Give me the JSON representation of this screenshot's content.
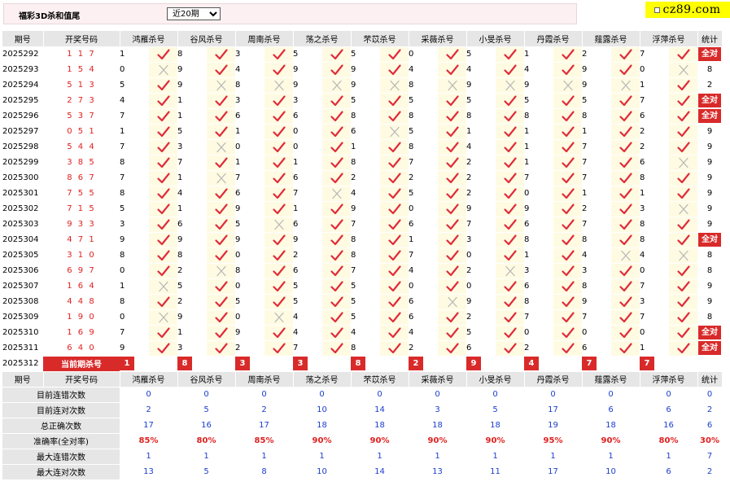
{
  "header": {
    "title": "福彩3D杀和值尾",
    "period_option": "近20期",
    "logo": "cz89.com"
  },
  "columns": [
    "期号",
    "开奖号码",
    "鸿雁杀号",
    "谷风杀号",
    "周南杀号",
    "荡之杀号",
    "芣苡杀号",
    "采薇杀号",
    "小旻杀号",
    "丹霞杀号",
    "薤露杀号",
    "浮萍杀号",
    "统计"
  ],
  "rows": [
    {
      "period": "2025292",
      "draw": "1 1 7",
      "kills": [
        [
          "1",
          "y"
        ],
        [
          "8",
          "y"
        ],
        [
          "3",
          "y"
        ],
        [
          "5",
          "y"
        ],
        [
          "5",
          "y"
        ],
        [
          "0",
          "y"
        ],
        [
          "5",
          "y"
        ],
        [
          "1",
          "y"
        ],
        [
          "2",
          "y"
        ],
        [
          "7",
          "y"
        ]
      ],
      "stat": "全对"
    },
    {
      "period": "2025293",
      "draw": "1 5 4",
      "kills": [
        [
          "0",
          "n"
        ],
        [
          "9",
          "y"
        ],
        [
          "4",
          "y"
        ],
        [
          "9",
          "y"
        ],
        [
          "9",
          "y"
        ],
        [
          "4",
          "y"
        ],
        [
          "4",
          "y"
        ],
        [
          "4",
          "y"
        ],
        [
          "9",
          "y"
        ],
        [
          "0",
          "n"
        ]
      ],
      "stat": "8"
    },
    {
      "period": "2025294",
      "draw": "5 1 3",
      "kills": [
        [
          "5",
          "y"
        ],
        [
          "9",
          "n"
        ],
        [
          "8",
          "n"
        ],
        [
          "9",
          "n"
        ],
        [
          "9",
          "n"
        ],
        [
          "8",
          "n"
        ],
        [
          "9",
          "n"
        ],
        [
          "9",
          "n"
        ],
        [
          "9",
          "n"
        ],
        [
          "1",
          "y"
        ]
      ],
      "stat": "2"
    },
    {
      "period": "2025295",
      "draw": "2 7 3",
      "kills": [
        [
          "4",
          "y"
        ],
        [
          "1",
          "y"
        ],
        [
          "3",
          "y"
        ],
        [
          "3",
          "y"
        ],
        [
          "5",
          "y"
        ],
        [
          "5",
          "y"
        ],
        [
          "5",
          "y"
        ],
        [
          "5",
          "y"
        ],
        [
          "5",
          "y"
        ],
        [
          "7",
          "y"
        ]
      ],
      "stat": "全对"
    },
    {
      "period": "2025296",
      "draw": "5 3 7",
      "kills": [
        [
          "7",
          "y"
        ],
        [
          "1",
          "y"
        ],
        [
          "6",
          "y"
        ],
        [
          "6",
          "y"
        ],
        [
          "8",
          "y"
        ],
        [
          "8",
          "y"
        ],
        [
          "8",
          "y"
        ],
        [
          "8",
          "y"
        ],
        [
          "8",
          "y"
        ],
        [
          "6",
          "y"
        ]
      ],
      "stat": "全对"
    },
    {
      "period": "2025297",
      "draw": "0 5 1",
      "kills": [
        [
          "1",
          "y"
        ],
        [
          "5",
          "y"
        ],
        [
          "1",
          "y"
        ],
        [
          "0",
          "y"
        ],
        [
          "6",
          "n"
        ],
        [
          "5",
          "y"
        ],
        [
          "1",
          "y"
        ],
        [
          "1",
          "y"
        ],
        [
          "1",
          "y"
        ],
        [
          "2",
          "y"
        ]
      ],
      "stat": "9"
    },
    {
      "period": "2025298",
      "draw": "5 4 4",
      "kills": [
        [
          "7",
          "y"
        ],
        [
          "3",
          "n"
        ],
        [
          "0",
          "y"
        ],
        [
          "0",
          "y"
        ],
        [
          "1",
          "y"
        ],
        [
          "8",
          "y"
        ],
        [
          "4",
          "y"
        ],
        [
          "1",
          "y"
        ],
        [
          "7",
          "y"
        ],
        [
          "2",
          "y"
        ]
      ],
      "stat": "9"
    },
    {
      "period": "2025299",
      "draw": "3 8 5",
      "kills": [
        [
          "8",
          "y"
        ],
        [
          "7",
          "y"
        ],
        [
          "1",
          "y"
        ],
        [
          "1",
          "y"
        ],
        [
          "8",
          "y"
        ],
        [
          "7",
          "y"
        ],
        [
          "2",
          "y"
        ],
        [
          "1",
          "y"
        ],
        [
          "7",
          "y"
        ],
        [
          "6",
          "n"
        ]
      ],
      "stat": "9"
    },
    {
      "period": "2025300",
      "draw": "8 6 7",
      "kills": [
        [
          "7",
          "y"
        ],
        [
          "1",
          "n"
        ],
        [
          "7",
          "y"
        ],
        [
          "6",
          "y"
        ],
        [
          "2",
          "y"
        ],
        [
          "2",
          "y"
        ],
        [
          "2",
          "y"
        ],
        [
          "7",
          "y"
        ],
        [
          "7",
          "y"
        ],
        [
          "8",
          "y"
        ]
      ],
      "stat": "9"
    },
    {
      "period": "2025301",
      "draw": "7 5 5",
      "kills": [
        [
          "8",
          "y"
        ],
        [
          "4",
          "y"
        ],
        [
          "6",
          "y"
        ],
        [
          "7",
          "n"
        ],
        [
          "4",
          "y"
        ],
        [
          "5",
          "y"
        ],
        [
          "2",
          "y"
        ],
        [
          "0",
          "y"
        ],
        [
          "1",
          "y"
        ],
        [
          "1",
          "y"
        ]
      ],
      "stat": "9"
    },
    {
      "period": "2025302",
      "draw": "7 1 5",
      "kills": [
        [
          "5",
          "y"
        ],
        [
          "1",
          "y"
        ],
        [
          "9",
          "y"
        ],
        [
          "1",
          "y"
        ],
        [
          "9",
          "y"
        ],
        [
          "0",
          "y"
        ],
        [
          "9",
          "y"
        ],
        [
          "9",
          "y"
        ],
        [
          "2",
          "y"
        ],
        [
          "3",
          "n"
        ]
      ],
      "stat": "9"
    },
    {
      "period": "2025303",
      "draw": "9 3 3",
      "kills": [
        [
          "3",
          "y"
        ],
        [
          "6",
          "y"
        ],
        [
          "5",
          "n"
        ],
        [
          "6",
          "y"
        ],
        [
          "7",
          "y"
        ],
        [
          "6",
          "y"
        ],
        [
          "7",
          "y"
        ],
        [
          "6",
          "y"
        ],
        [
          "7",
          "y"
        ],
        [
          "8",
          "y"
        ]
      ],
      "stat": "9"
    },
    {
      "period": "2025304",
      "draw": "4 7 1",
      "kills": [
        [
          "9",
          "y"
        ],
        [
          "9",
          "y"
        ],
        [
          "9",
          "y"
        ],
        [
          "9",
          "y"
        ],
        [
          "8",
          "y"
        ],
        [
          "1",
          "y"
        ],
        [
          "3",
          "y"
        ],
        [
          "8",
          "y"
        ],
        [
          "8",
          "y"
        ],
        [
          "8",
          "y"
        ]
      ],
      "stat": "全对"
    },
    {
      "period": "2025305",
      "draw": "3 1 0",
      "kills": [
        [
          "8",
          "y"
        ],
        [
          "8",
          "y"
        ],
        [
          "0",
          "y"
        ],
        [
          "2",
          "y"
        ],
        [
          "8",
          "y"
        ],
        [
          "7",
          "y"
        ],
        [
          "0",
          "y"
        ],
        [
          "1",
          "y"
        ],
        [
          "4",
          "n"
        ],
        [
          "4",
          "n"
        ]
      ],
      "stat": "8"
    },
    {
      "period": "2025306",
      "draw": "6 9 7",
      "kills": [
        [
          "0",
          "y"
        ],
        [
          "2",
          "n"
        ],
        [
          "8",
          "y"
        ],
        [
          "6",
          "y"
        ],
        [
          "7",
          "y"
        ],
        [
          "4",
          "y"
        ],
        [
          "2",
          "n"
        ],
        [
          "3",
          "y"
        ],
        [
          "3",
          "y"
        ],
        [
          "0",
          "y"
        ]
      ],
      "stat": "8"
    },
    {
      "period": "2025307",
      "draw": "1 6 4",
      "kills": [
        [
          "1",
          "n"
        ],
        [
          "5",
          "y"
        ],
        [
          "0",
          "y"
        ],
        [
          "5",
          "y"
        ],
        [
          "5",
          "y"
        ],
        [
          "0",
          "y"
        ],
        [
          "0",
          "y"
        ],
        [
          "6",
          "y"
        ],
        [
          "8",
          "y"
        ],
        [
          "7",
          "y"
        ]
      ],
      "stat": "9"
    },
    {
      "period": "2025308",
      "draw": "4 4 8",
      "kills": [
        [
          "8",
          "y"
        ],
        [
          "2",
          "y"
        ],
        [
          "5",
          "y"
        ],
        [
          "5",
          "y"
        ],
        [
          "5",
          "y"
        ],
        [
          "6",
          "n"
        ],
        [
          "9",
          "y"
        ],
        [
          "8",
          "y"
        ],
        [
          "9",
          "y"
        ],
        [
          "3",
          "y"
        ]
      ],
      "stat": "9"
    },
    {
      "period": "2025309",
      "draw": "1 9 0",
      "kills": [
        [
          "0",
          "n"
        ],
        [
          "9",
          "y"
        ],
        [
          "0",
          "n"
        ],
        [
          "4",
          "y"
        ],
        [
          "5",
          "y"
        ],
        [
          "6",
          "y"
        ],
        [
          "2",
          "y"
        ],
        [
          "7",
          "y"
        ],
        [
          "7",
          "y"
        ],
        [
          "7",
          "y"
        ]
      ],
      "stat": "8"
    },
    {
      "period": "2025310",
      "draw": "1 6 9",
      "kills": [
        [
          "7",
          "y"
        ],
        [
          "1",
          "y"
        ],
        [
          "9",
          "y"
        ],
        [
          "4",
          "y"
        ],
        [
          "4",
          "y"
        ],
        [
          "4",
          "y"
        ],
        [
          "5",
          "y"
        ],
        [
          "0",
          "y"
        ],
        [
          "0",
          "y"
        ],
        [
          "0",
          "y"
        ]
      ],
      "stat": "全对"
    },
    {
      "period": "2025311",
      "draw": "6 4 0",
      "kills": [
        [
          "9",
          "y"
        ],
        [
          "3",
          "y"
        ],
        [
          "2",
          "y"
        ],
        [
          "7",
          "y"
        ],
        [
          "8",
          "y"
        ],
        [
          "2",
          "y"
        ],
        [
          "6",
          "y"
        ],
        [
          "2",
          "y"
        ],
        [
          "6",
          "y"
        ],
        [
          "1",
          "y"
        ]
      ],
      "stat": "全对"
    }
  ],
  "current": {
    "period": "2025312",
    "label": "当前期杀号",
    "kills": [
      "1",
      "8",
      "3",
      "3",
      "8",
      "2",
      "9",
      "4",
      "7",
      "7"
    ]
  },
  "stats": [
    {
      "label": "目前连错次数",
      "values": [
        "0",
        "0",
        "0",
        "0",
        "0",
        "0",
        "0",
        "0",
        "0",
        "0",
        "0"
      ]
    },
    {
      "label": "目前连对次数",
      "values": [
        "2",
        "5",
        "2",
        "10",
        "14",
        "3",
        "5",
        "17",
        "6",
        "6",
        "2"
      ]
    },
    {
      "label": "总正确次数",
      "values": [
        "17",
        "16",
        "17",
        "18",
        "18",
        "18",
        "18",
        "19",
        "18",
        "16",
        "6"
      ]
    },
    {
      "label": "准确率(全对率)",
      "values": [
        "85%",
        "80%",
        "85%",
        "90%",
        "90%",
        "90%",
        "90%",
        "95%",
        "90%",
        "80%",
        "30%"
      ],
      "pct": true
    },
    {
      "label": "最大连错次数",
      "values": [
        "1",
        "1",
        "1",
        "1",
        "1",
        "1",
        "1",
        "1",
        "1",
        "1",
        "7"
      ]
    },
    {
      "label": "最大连对次数",
      "values": [
        "13",
        "5",
        "8",
        "10",
        "14",
        "13",
        "11",
        "17",
        "10",
        "6",
        "2"
      ]
    }
  ],
  "colors": {
    "accent": "#d92a2a",
    "header_bg": "#e6e6e6",
    "mark_bg": "#fffbe3",
    "stat_blue": "#1a3fcf"
  },
  "icons": {
    "correct": "check-icon",
    "wrong": "cross-icon"
  }
}
